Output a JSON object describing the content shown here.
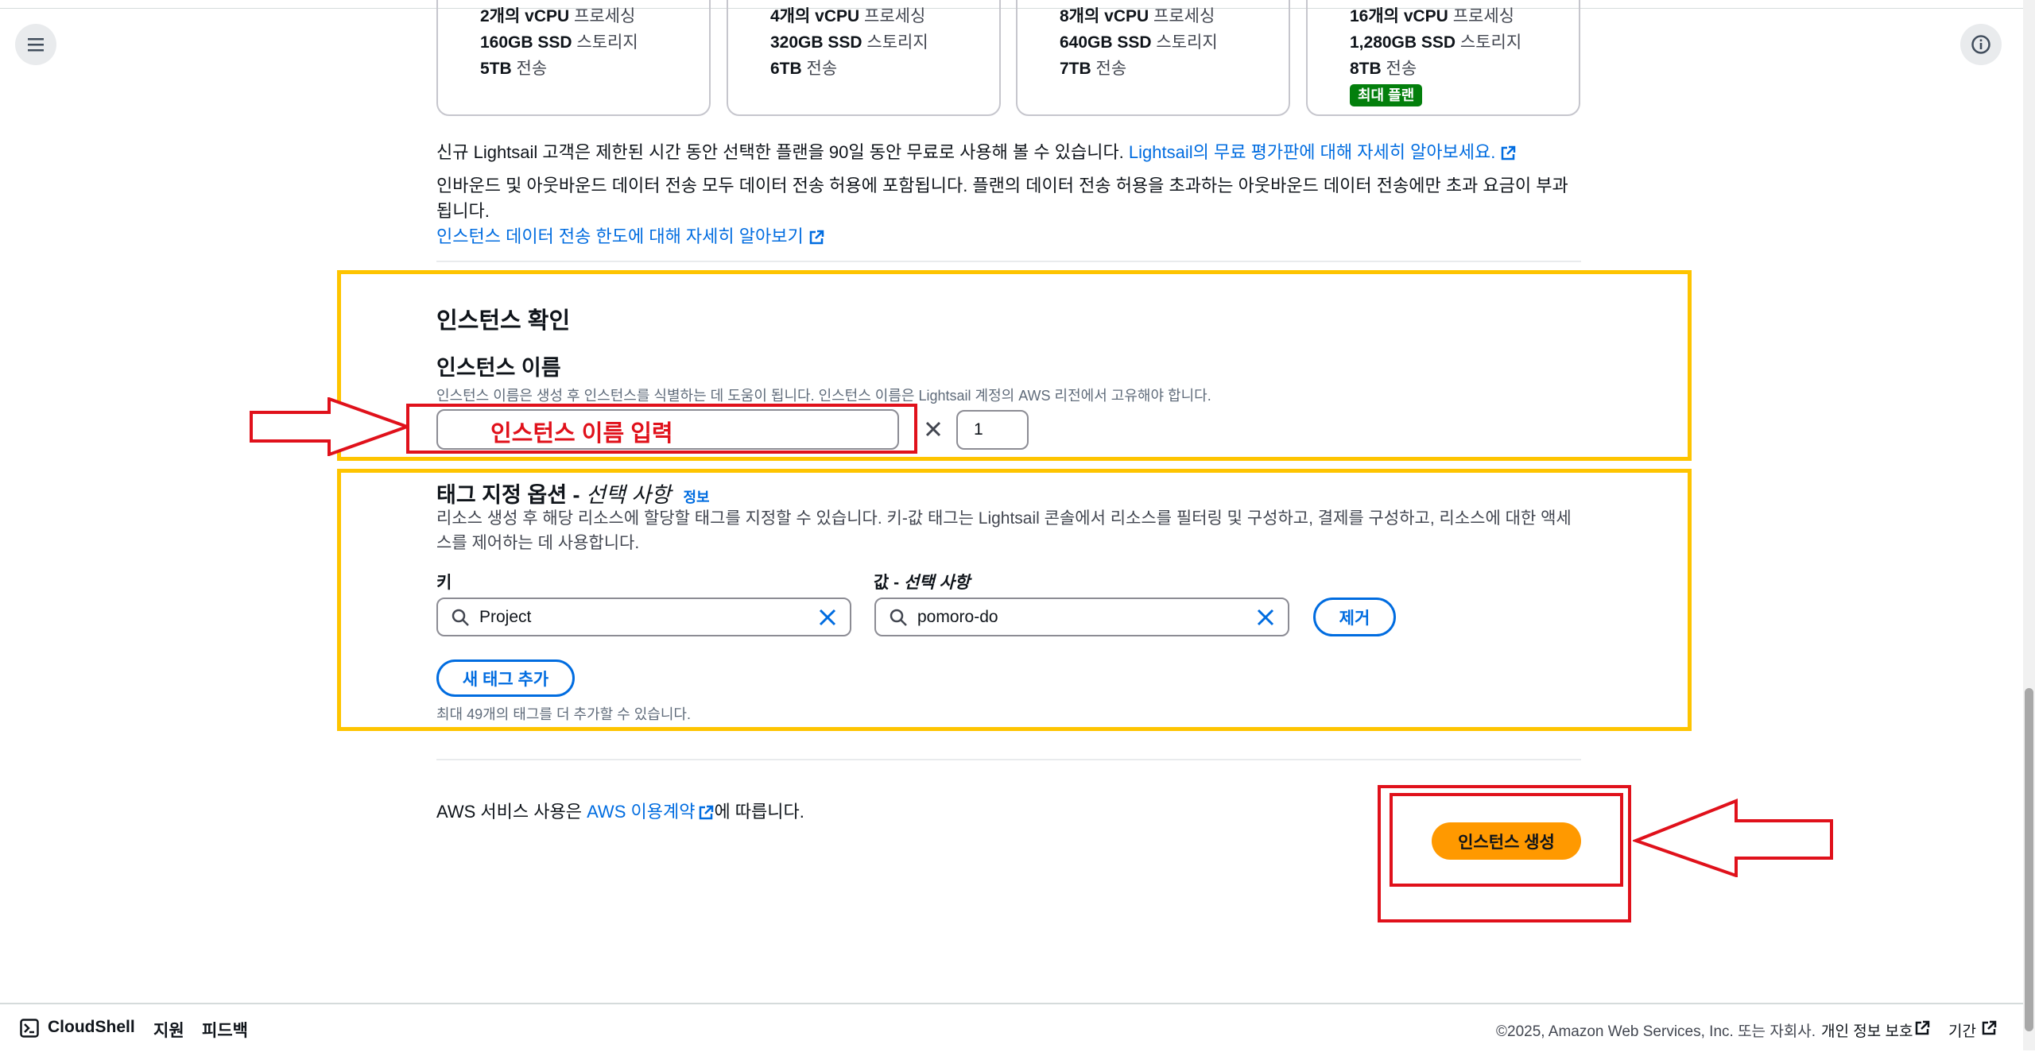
{
  "plans": [
    {
      "vcpu": "2개의 vCPU",
      "vcpu_suffix": " 프로세싱",
      "ssd": "160GB SSD",
      "ssd_suffix": " 스토리지",
      "transfer": "5TB",
      "transfer_suffix": " 전송"
    },
    {
      "vcpu": "4개의 vCPU",
      "vcpu_suffix": " 프로세싱",
      "ssd": "320GB SSD",
      "ssd_suffix": " 스토리지",
      "transfer": "6TB",
      "transfer_suffix": " 전송"
    },
    {
      "vcpu": "8개의 vCPU",
      "vcpu_suffix": " 프로세싱",
      "ssd": "640GB SSD",
      "ssd_suffix": " 스토리지",
      "transfer": "7TB",
      "transfer_suffix": " 전송"
    },
    {
      "vcpu": "16개의 vCPU",
      "vcpu_suffix": " 프로세싱",
      "ssd": "1,280GB SSD",
      "ssd_suffix": " 스토리지",
      "transfer": "8TB",
      "transfer_suffix": " 전송",
      "badge": "최대 플랜"
    }
  ],
  "free_tier": {
    "text": "신규 Lightsail 고객은 제한된 시간 동안 선택한 플랜을 90일 동안 무료로 사용해 볼 수 있습니다. ",
    "link": "Lightsail의 무료 평가판에 대해 자세히 알아보세요."
  },
  "transfer_note": {
    "text": "인바운드 및 아웃바운드 데이터 전송 모두 데이터 전송 허용에 포함됩니다. 플랜의 데이터 전송 허용을 초과하는 아웃바운드 데이터 전송에만 초과 요금이 부과됩니다.",
    "link": "인스턴스 데이터 전송 한도에 대해 자세히 알아보기"
  },
  "confirm": {
    "heading": "인스턴스 확인",
    "name_label": "인스턴스 이름",
    "name_desc": "인스턴스 이름은 생성 후 인스턴스를 식별하는 데 도움이 됩니다. 인스턴스 이름은 Lightsail 계정의 AWS 리전에서 고유해야 합니다.",
    "name_annotation": "인스턴스 이름 입력",
    "multiply": "×",
    "count": "1"
  },
  "tags": {
    "heading": "태그 지정 옵션 - ",
    "heading_optional": "선택 사항",
    "info_link": "정보",
    "desc_line1": "리소스 생성 후 해당 리소스에 할당할 태그를 지정할 수 있습니다. 키-값 태그는 Lightsail 콘솔에서 리소스를 필터링 및 구성하고, 결제를 구성하고, 리소스에 대한 액세",
    "desc_line2": "스를 제어하는 데 사용합니다.",
    "key_label": "키",
    "value_label": "값 - ",
    "value_label_optional": "선택 사항",
    "key_value": "Project",
    "value_value": "pomoro-do",
    "remove_button": "제거",
    "add_button": "새 태그 추가",
    "limit_note": "최대 49개의 태그를 더 추가할 수 있습니다."
  },
  "terms": {
    "prefix": "AWS 서비스 사용은 ",
    "link": "AWS 이용계약",
    "suffix": "에 따릅니다."
  },
  "create_button": "인스턴스 생성",
  "footer": {
    "cloudshell": "CloudShell",
    "support": "지원",
    "feedback": "피드백",
    "copyright": "©2025, Amazon Web Services, Inc. 또는 자회사.",
    "privacy": "개인 정보 보호",
    "terms": "기간"
  },
  "colors": {
    "annotation_red": "#e0111b",
    "highlight_yellow": "#fec400",
    "primary_orange": "#ff9900",
    "link_blue": "#006ce0"
  }
}
